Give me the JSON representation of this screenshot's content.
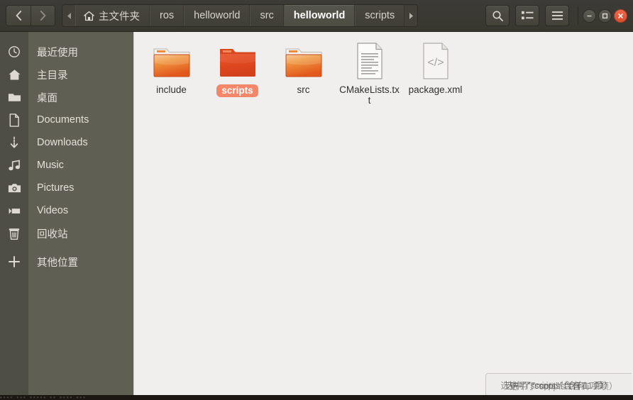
{
  "window": {
    "title": "helloworld",
    "colors": {
      "headerbar": "#3a3933",
      "sidebar": "#605f53",
      "sidebar_iconcol": "#4f4e45",
      "content": "#f0efee",
      "selection": "#f4876a",
      "folder": "#e8702a",
      "close_button": "#e2553d"
    }
  },
  "header": {
    "nav": {
      "back_label": "‹",
      "forward_label": "›"
    },
    "pathbar": {
      "left_arrow": "◂",
      "right_arrow": "▸",
      "crumbs": [
        {
          "label": "主文件夹",
          "icon": "home-icon",
          "active": false
        },
        {
          "label": "ros",
          "active": false
        },
        {
          "label": "helloworld",
          "active": false
        },
        {
          "label": "src",
          "active": false
        },
        {
          "label": "helloworld",
          "active": true
        },
        {
          "label": "scripts",
          "active": false
        }
      ]
    },
    "tools": [
      {
        "name": "search-button",
        "icon": "search-icon"
      },
      {
        "name": "view-options-button",
        "icon": "list-view-icon"
      },
      {
        "name": "menu-button",
        "icon": "hamburger-menu-icon"
      }
    ],
    "window_controls": [
      {
        "name": "minimize-button",
        "icon": "minimize-icon"
      },
      {
        "name": "maximize-button",
        "icon": "maximize-icon"
      },
      {
        "name": "close-button",
        "icon": "close-icon"
      }
    ]
  },
  "sidebar": {
    "items": [
      {
        "label": "最近使用",
        "icon": "clock-icon",
        "name": "sidebar-item-recent"
      },
      {
        "label": "主目录",
        "icon": "home-icon",
        "name": "sidebar-item-home"
      },
      {
        "label": "桌面",
        "icon": "folder-icon",
        "name": "sidebar-item-desktop"
      },
      {
        "label": "Documents",
        "icon": "document-icon",
        "name": "sidebar-item-documents"
      },
      {
        "label": "Downloads",
        "icon": "download-icon",
        "name": "sidebar-item-downloads"
      },
      {
        "label": "Music",
        "icon": "music-note-icon",
        "name": "sidebar-item-music"
      },
      {
        "label": "Pictures",
        "icon": "camera-icon",
        "name": "sidebar-item-pictures"
      },
      {
        "label": "Videos",
        "icon": "video-camera-icon",
        "name": "sidebar-item-videos"
      },
      {
        "label": "回收站",
        "icon": "trash-icon",
        "name": "sidebar-item-trash"
      },
      {
        "label": "其他位置",
        "icon": "plus-icon",
        "name": "sidebar-item-other-locations"
      }
    ]
  },
  "content": {
    "files": [
      {
        "name": "include",
        "type": "folder",
        "selected": false
      },
      {
        "name": "scripts",
        "type": "folder",
        "selected": true
      },
      {
        "name": "src",
        "type": "folder",
        "selected": false
      },
      {
        "name": "CMakeLists.txt",
        "type": "text-file",
        "selected": false
      },
      {
        "name": "package.xml",
        "type": "code-file",
        "selected": false
      }
    ]
  },
  "status": {
    "text": "选中了“scripts”（含有 1 项）"
  },
  "bottom_strip": {
    "text": "•••• ••• ••••• •• •••• •••"
  }
}
